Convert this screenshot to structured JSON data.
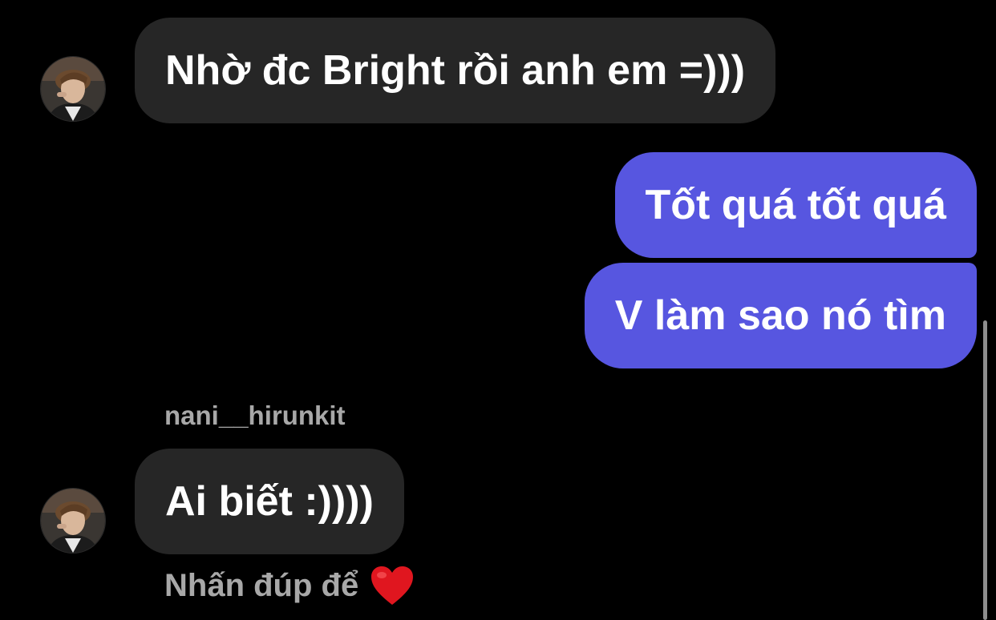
{
  "thread": {
    "messages": [
      {
        "text": "Nhờ đc Bright rồi anh em =)))",
        "direction": "incoming"
      },
      {
        "text": "Tốt quá tốt quá",
        "direction": "outgoing"
      },
      {
        "text": "V làm sao nó tìm",
        "direction": "outgoing"
      },
      {
        "text": "Ai biết :))))",
        "direction": "incoming",
        "sender": "nani__hirunkit"
      }
    ],
    "double_tap_hint": "Nhấn đúp để",
    "hint_icon": "heart-emoji-icon"
  },
  "colors": {
    "background": "#000000",
    "incoming_bubble": "#262626",
    "outgoing_bubble": "#5756e0",
    "secondary_text": "#a8a8a8",
    "heart": "#e0161f"
  }
}
